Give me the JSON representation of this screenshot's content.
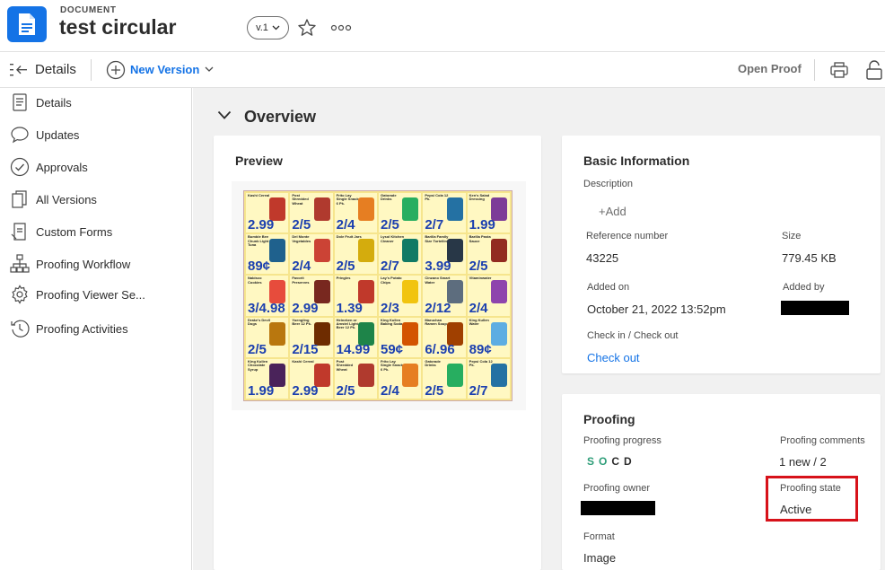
{
  "header": {
    "doc_kind": "DOCUMENT",
    "title": "test circular",
    "version": "v.1"
  },
  "toolbar": {
    "panel_title": "Details",
    "new_version_label": "New Version",
    "open_proof_label": "Open Proof"
  },
  "sidebar": {
    "items": [
      {
        "label": "Details",
        "icon": "document-lines-icon"
      },
      {
        "label": "Updates",
        "icon": "speech-bubble-icon"
      },
      {
        "label": "Approvals",
        "icon": "check-circle-icon"
      },
      {
        "label": "All Versions",
        "icon": "versions-icon"
      },
      {
        "label": "Custom Forms",
        "icon": "form-icon"
      },
      {
        "label": "Proofing Workflow",
        "icon": "workflow-icon"
      },
      {
        "label": "Proofing Viewer Se...",
        "icon": "gear-icon"
      },
      {
        "label": "Proofing Activities",
        "icon": "activity-icon"
      }
    ]
  },
  "overview": {
    "title": "Overview",
    "preview": {
      "title": "Preview",
      "circular_cells": [
        {
          "caption": "Kashi Cereal",
          "price": "2.99",
          "color": "#c0392b"
        },
        {
          "caption": "Post Shredded Wheat",
          "price": "2/5",
          "color": "#b03a2e"
        },
        {
          "caption": "Frito Lay Single Snacks 6 Pk.",
          "price": "2/4",
          "color": "#e67e22"
        },
        {
          "caption": "Gatorade Drinks",
          "price": "2/5",
          "color": "#27ae60"
        },
        {
          "caption": "Pepsi Cola 12 Pk.",
          "price": "2/7",
          "color": "#2471a3"
        },
        {
          "caption": "Ken's Salad Dressing",
          "price": "1.99",
          "color": "#7d3c98"
        },
        {
          "caption": "Bumble Bee Chunk Light Tuna",
          "price": "89¢",
          "color": "#1f618d"
        },
        {
          "caption": "Del Monte Vegetables",
          "price": "2/4",
          "color": "#cb4335"
        },
        {
          "caption": "Dole Fruit Jars",
          "price": "2/5",
          "color": "#d4ac0d"
        },
        {
          "caption": "Lysol Kitchen Cleaner",
          "price": "2/7",
          "color": "#117a65"
        },
        {
          "caption": "Barilla Family Size Tortellini",
          "price": "3.99",
          "color": "#283747"
        },
        {
          "caption": "Barilla Pasta Sauce",
          "price": "2/5",
          "color": "#922b21"
        },
        {
          "caption": "Nabisco Cookies",
          "price": "3/4.98",
          "color": "#e74c3c"
        },
        {
          "caption": "Favorit Preserves",
          "price": "2.99",
          "color": "#78281f"
        },
        {
          "caption": "Pringles",
          "price": "1.39",
          "color": "#c0392b"
        },
        {
          "caption": "Lay's Potato Chips",
          "price": "2/3",
          "color": "#f1c40f"
        },
        {
          "caption": "Cinzano Smart Water",
          "price": "2/12",
          "color": "#5d6d7e"
        },
        {
          "caption": "Vitaminwater",
          "price": "2/4",
          "color": "#8e44ad"
        },
        {
          "caption": "Drake's Devil Dogs",
          "price": "2/5",
          "color": "#b9770e"
        },
        {
          "caption": "Yuengling Beer 12 Pk.",
          "price": "2/15",
          "color": "#6e2c00"
        },
        {
          "caption": "Heineken or Amstel Light Beer 12 Pk.",
          "price": "14.99",
          "color": "#1e8449"
        },
        {
          "caption": "King Kullen Baking Soda",
          "price": "59¢",
          "color": "#d35400"
        },
        {
          "caption": "Maruchan Ramen Soup",
          "price": "6/.96",
          "color": "#a04000"
        },
        {
          "caption": "King Kullen Water",
          "price": "89¢",
          "color": "#5dade2"
        },
        {
          "caption": "King Kullen Chocolate Syrup",
          "price": "1.99",
          "color": "#4a235a"
        }
      ]
    },
    "basic": {
      "title": "Basic Information",
      "description_label": "Description",
      "add_label": "+Add",
      "reference_label": "Reference number",
      "reference_value": "43225",
      "size_label": "Size",
      "size_value": "779.45 KB",
      "added_on_label": "Added on",
      "added_on_value": "October 21, 2022 13:52pm",
      "added_by_label": "Added by",
      "checkin_label": "Check in / Check out",
      "checkout_link": "Check out"
    },
    "proofing": {
      "title": "Proofing",
      "progress_label": "Proofing progress",
      "progress_letters": [
        "S",
        "O",
        "C",
        "D"
      ],
      "comments_label": "Proofing comments",
      "comments_value": "1 new / 2",
      "owner_label": "Proofing owner",
      "state_label": "Proofing state",
      "state_value": "Active",
      "format_label": "Format",
      "format_value": "Image"
    }
  },
  "colors": {
    "accent": "#1473e6",
    "highlight": "#d7121a",
    "progress_done": "#2d9d78"
  }
}
